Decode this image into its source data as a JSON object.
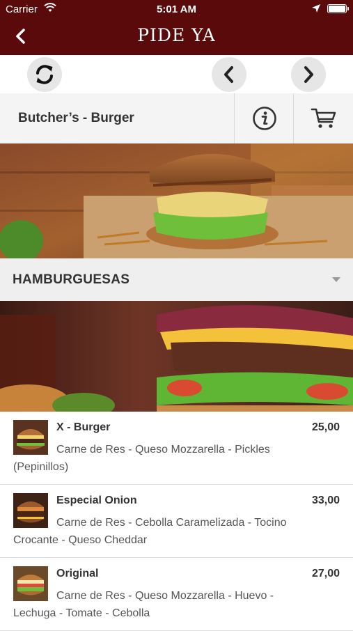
{
  "status_bar": {
    "carrier": "Carrier",
    "time": "5:01 AM"
  },
  "nav": {
    "title": "PIDE YA",
    "back_icon": "chevron-left-icon"
  },
  "toolbar": {
    "refresh_icon": "refresh-icon",
    "prev_icon": "chevron-left-icon",
    "next_icon": "chevron-right-icon"
  },
  "restaurant": {
    "name": "Butcher’s - Burger",
    "info_icon": "info-icon",
    "cart_icon": "cart-icon"
  },
  "category": {
    "label": "HAMBURGUESAS"
  },
  "items": [
    {
      "name": "X - Burger",
      "price": "25,00",
      "description": "Carne de Res - Queso Mozzarella - Pickles (Pepinillos)"
    },
    {
      "name": "Especial Onion",
      "price": "33,00",
      "description": "Carne de Res - Cebolla Caramelizada - Tocino Crocante - Queso Cheddar"
    },
    {
      "name": "Original",
      "price": "27,00",
      "description": "Carne de Res - Queso Mozzarella - Huevo - Lechuga - Tomate - Cebolla"
    }
  ],
  "colors": {
    "nav_bg": "#5a0a0b",
    "button_bg": "#e6e6e6",
    "category_bg": "#efefef"
  }
}
